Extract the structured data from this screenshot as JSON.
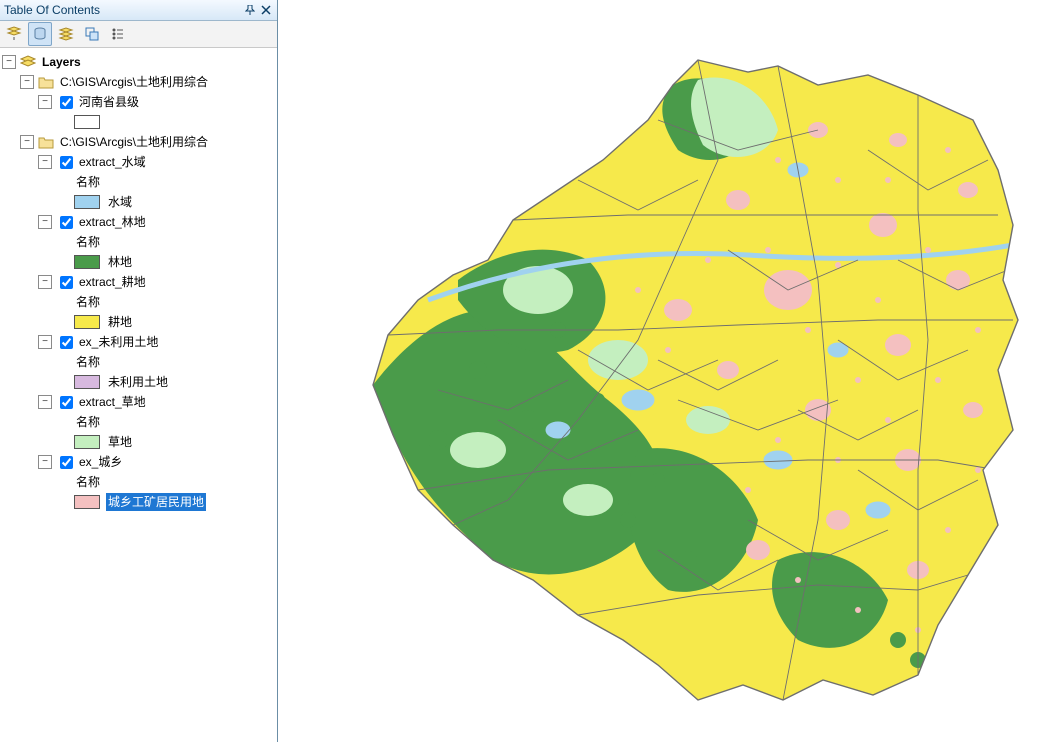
{
  "panel": {
    "title": "Table Of Contents"
  },
  "toolbar": {
    "buttons": [
      "list-drawing-order",
      "list-source",
      "list-visibility",
      "list-selection",
      "options"
    ]
  },
  "tree": {
    "root_label": "Layers",
    "group1": {
      "path": "C:\\GIS\\Arcgis\\土地利用综合",
      "layer": {
        "name": "河南省县级"
      }
    },
    "group2": {
      "path": "C:\\GIS\\Arcgis\\土地利用综合",
      "layers": [
        {
          "name": "extract_水域",
          "field": "名称",
          "class_label": "水域",
          "color": "#a0d2ef"
        },
        {
          "name": "extract_林地",
          "field": "名称",
          "class_label": "林地",
          "color": "#4a9b4a"
        },
        {
          "name": "extract_耕地",
          "field": "名称",
          "class_label": "耕地",
          "color": "#f6e94b"
        },
        {
          "name": "ex_未利用土地",
          "field": "名称",
          "class_label": "未利用土地",
          "color": "#d7b9df"
        },
        {
          "name": "extract_草地",
          "field": "名称",
          "class_label": "草地",
          "color": "#c4efbf"
        },
        {
          "name": "ex_城乡",
          "field": "名称",
          "class_label": "城乡工矿居民用地",
          "color": "#f4c0c0",
          "selected": true
        }
      ]
    }
  },
  "colors": {
    "耕地": "#f6e94b",
    "林地": "#4a9b4a",
    "草地": "#c4efbf",
    "水域": "#a0d2ef",
    "城乡": "#f4c0c0",
    "未利用": "#d7b9df",
    "boundary": "#6e6e6e"
  }
}
